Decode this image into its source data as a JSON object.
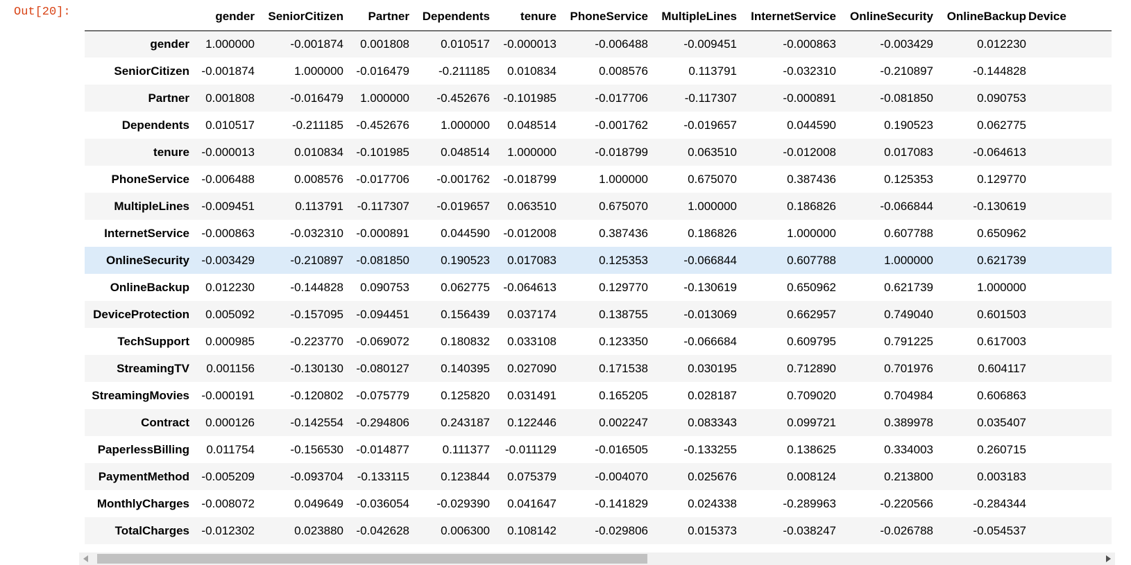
{
  "prompt": "Out[20]:",
  "columns": [
    "gender",
    "SeniorCitizen",
    "Partner",
    "Dependents",
    "tenure",
    "PhoneService",
    "MultipleLines",
    "InternetService",
    "OnlineSecurity",
    "OnlineBackup",
    "Device"
  ],
  "rows": [
    {
      "label": "gender",
      "values": [
        "1.000000",
        "-0.001874",
        "0.001808",
        "0.010517",
        "-0.000013",
        "-0.006488",
        "-0.009451",
        "-0.000863",
        "-0.003429",
        "0.012230",
        ""
      ]
    },
    {
      "label": "SeniorCitizen",
      "values": [
        "-0.001874",
        "1.000000",
        "-0.016479",
        "-0.211185",
        "0.010834",
        "0.008576",
        "0.113791",
        "-0.032310",
        "-0.210897",
        "-0.144828",
        ""
      ]
    },
    {
      "label": "Partner",
      "values": [
        "0.001808",
        "-0.016479",
        "1.000000",
        "-0.452676",
        "-0.101985",
        "-0.017706",
        "-0.117307",
        "-0.000891",
        "-0.081850",
        "0.090753",
        ""
      ]
    },
    {
      "label": "Dependents",
      "values": [
        "0.010517",
        "-0.211185",
        "-0.452676",
        "1.000000",
        "0.048514",
        "-0.001762",
        "-0.019657",
        "0.044590",
        "0.190523",
        "0.062775",
        ""
      ]
    },
    {
      "label": "tenure",
      "values": [
        "-0.000013",
        "0.010834",
        "-0.101985",
        "0.048514",
        "1.000000",
        "-0.018799",
        "0.063510",
        "-0.012008",
        "0.017083",
        "-0.064613",
        ""
      ]
    },
    {
      "label": "PhoneService",
      "values": [
        "-0.006488",
        "0.008576",
        "-0.017706",
        "-0.001762",
        "-0.018799",
        "1.000000",
        "0.675070",
        "0.387436",
        "0.125353",
        "0.129770",
        ""
      ]
    },
    {
      "label": "MultipleLines",
      "values": [
        "-0.009451",
        "0.113791",
        "-0.117307",
        "-0.019657",
        "0.063510",
        "0.675070",
        "1.000000",
        "0.186826",
        "-0.066844",
        "-0.130619",
        ""
      ]
    },
    {
      "label": "InternetService",
      "values": [
        "-0.000863",
        "-0.032310",
        "-0.000891",
        "0.044590",
        "-0.012008",
        "0.387436",
        "0.186826",
        "1.000000",
        "0.607788",
        "0.650962",
        ""
      ]
    },
    {
      "label": "OnlineSecurity",
      "values": [
        "-0.003429",
        "-0.210897",
        "-0.081850",
        "0.190523",
        "0.017083",
        "0.125353",
        "-0.066844",
        "0.607788",
        "1.000000",
        "0.621739",
        ""
      ]
    },
    {
      "label": "OnlineBackup",
      "values": [
        "0.012230",
        "-0.144828",
        "0.090753",
        "0.062775",
        "-0.064613",
        "0.129770",
        "-0.130619",
        "0.650962",
        "0.621739",
        "1.000000",
        ""
      ]
    },
    {
      "label": "DeviceProtection",
      "values": [
        "0.005092",
        "-0.157095",
        "-0.094451",
        "0.156439",
        "0.037174",
        "0.138755",
        "-0.013069",
        "0.662957",
        "0.749040",
        "0.601503",
        ""
      ]
    },
    {
      "label": "TechSupport",
      "values": [
        "0.000985",
        "-0.223770",
        "-0.069072",
        "0.180832",
        "0.033108",
        "0.123350",
        "-0.066684",
        "0.609795",
        "0.791225",
        "0.617003",
        ""
      ]
    },
    {
      "label": "StreamingTV",
      "values": [
        "0.001156",
        "-0.130130",
        "-0.080127",
        "0.140395",
        "0.027090",
        "0.171538",
        "0.030195",
        "0.712890",
        "0.701976",
        "0.604117",
        ""
      ]
    },
    {
      "label": "StreamingMovies",
      "values": [
        "-0.000191",
        "-0.120802",
        "-0.075779",
        "0.125820",
        "0.031491",
        "0.165205",
        "0.028187",
        "0.709020",
        "0.704984",
        "0.606863",
        ""
      ]
    },
    {
      "label": "Contract",
      "values": [
        "0.000126",
        "-0.142554",
        "-0.294806",
        "0.243187",
        "0.122446",
        "0.002247",
        "0.083343",
        "0.099721",
        "0.389978",
        "0.035407",
        ""
      ]
    },
    {
      "label": "PaperlessBilling",
      "values": [
        "0.011754",
        "-0.156530",
        "-0.014877",
        "0.111377",
        "-0.011129",
        "-0.016505",
        "-0.133255",
        "0.138625",
        "0.334003",
        "0.260715",
        ""
      ]
    },
    {
      "label": "PaymentMethod",
      "values": [
        "-0.005209",
        "-0.093704",
        "-0.133115",
        "0.123844",
        "0.075379",
        "-0.004070",
        "0.025676",
        "0.008124",
        "0.213800",
        "0.003183",
        ""
      ]
    },
    {
      "label": "MonthlyCharges",
      "values": [
        "-0.008072",
        "0.049649",
        "-0.036054",
        "-0.029390",
        "0.041647",
        "-0.141829",
        "0.024338",
        "-0.289963",
        "-0.220566",
        "-0.284344",
        ""
      ]
    },
    {
      "label": "TotalCharges",
      "values": [
        "-0.012302",
        "0.023880",
        "-0.042628",
        "0.006300",
        "0.108142",
        "-0.029806",
        "0.015373",
        "-0.038247",
        "-0.026788",
        "-0.054537",
        ""
      ]
    }
  ],
  "hovered_row": "OnlineSecurity",
  "colors": {
    "prompt": "#d84315",
    "row_stripe": "#f5f5f5",
    "row_hover": "#dcebf9"
  },
  "scrollbar": {
    "left_icon": "chevron-left-icon",
    "right_icon": "chevron-right-icon",
    "position": 0.0,
    "visible_fraction": 0.55
  }
}
